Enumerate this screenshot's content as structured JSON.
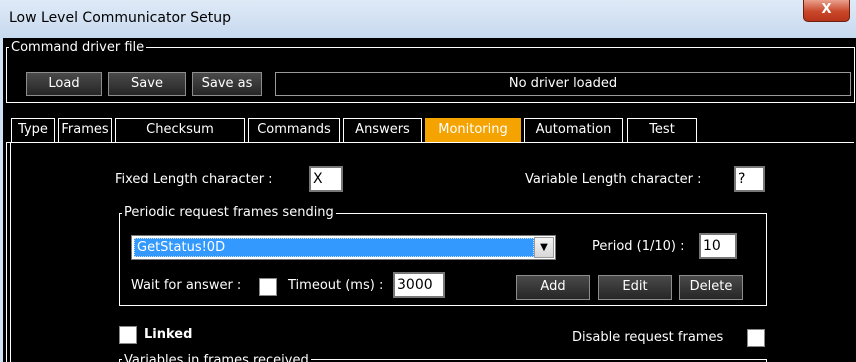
{
  "window": {
    "title": "Low Level Communicator Setup",
    "close_label": "X"
  },
  "driver": {
    "group_label": "Command driver file",
    "load_label": "Load",
    "save_label": "Save",
    "save_as_label": "Save as",
    "status": "No driver loaded"
  },
  "tabs": [
    {
      "label": "Type"
    },
    {
      "label": "Frames"
    },
    {
      "label": "Checksum"
    },
    {
      "label": "Commands"
    },
    {
      "label": "Answers"
    },
    {
      "label": "Monitoring",
      "active": true
    },
    {
      "label": "Automation"
    },
    {
      "label": "Test"
    }
  ],
  "monitoring": {
    "fixed_length_label": "Fixed Length character  :",
    "fixed_length_value": "X",
    "variable_length_label": "Variable Length character  :",
    "variable_length_value": "?",
    "periodic_group_label": "Periodic request frames sending",
    "frame_selected": "GetStatus!0D",
    "period_label": "Period (1/10) :",
    "period_value": "10",
    "wait_for_answer_label": "Wait for answer :",
    "timeout_label": "Timeout (ms) :",
    "timeout_value": "3000",
    "add_label": "Add",
    "edit_label": "Edit",
    "delete_label": "Delete",
    "linked_label": "Linked",
    "disable_request_label": "Disable request frames",
    "variables_group_label": "Variables in frames received"
  },
  "colors": {
    "active_tab": "#f5a300",
    "selection": "#3399ff",
    "background": "#000000"
  }
}
